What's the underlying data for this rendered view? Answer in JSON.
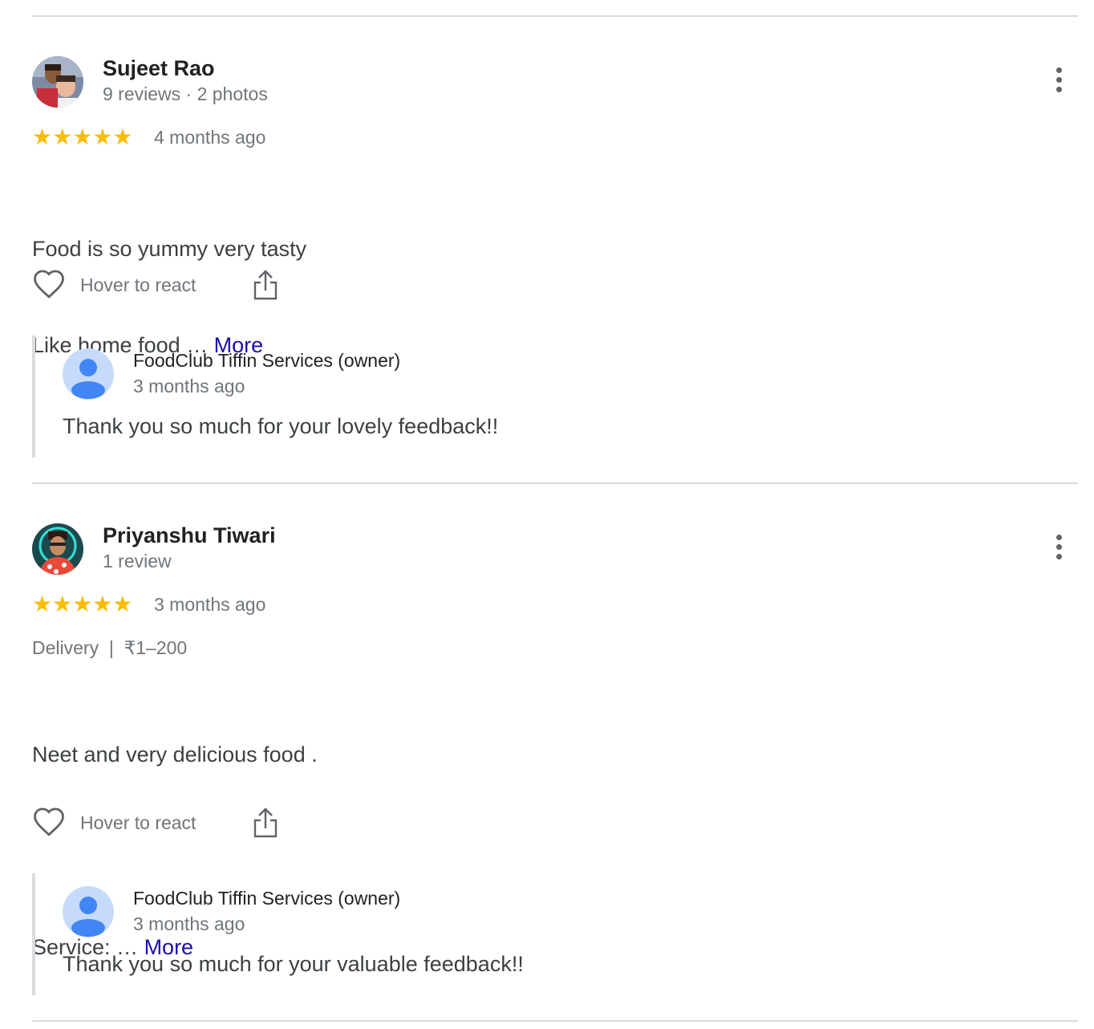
{
  "reviews": [
    {
      "author": "Sujeet Rao",
      "meta": "9 reviews · 2 photos",
      "rating": 5,
      "stars": "★★★★★",
      "time": "4 months ago",
      "text_line1": "Food is so yummy very tasty",
      "text_line2": "Like home food …",
      "more_label": "More",
      "react_label": "Hover to react",
      "reply": {
        "owner": "FoodClub Tiffin Services (owner)",
        "time": "3 months ago",
        "text": "Thank you so much for your lovely feedback!!"
      }
    },
    {
      "author": "Priyanshu Tiwari",
      "meta": "1 review",
      "rating": 5,
      "stars": "★★★★★",
      "time": "3 months ago",
      "tags": "Delivery  |  ₹1–200",
      "text_line1": "Neet and very delicious food .",
      "text_line2": "Service: …",
      "more_label": "More",
      "react_label": "Hover to react",
      "reply": {
        "owner": "FoodClub Tiffin Services (owner)",
        "time": "3 months ago",
        "text": "Thank you so much for your valuable feedback!!"
      }
    }
  ],
  "colors": {
    "star": "#fbbc04",
    "link": "#1a0dab",
    "divider": "#dadce0"
  },
  "icons": {
    "menu": "more-vert-icon",
    "react": "heart-icon",
    "share": "share-icon",
    "owner_avatar": "person-icon"
  }
}
